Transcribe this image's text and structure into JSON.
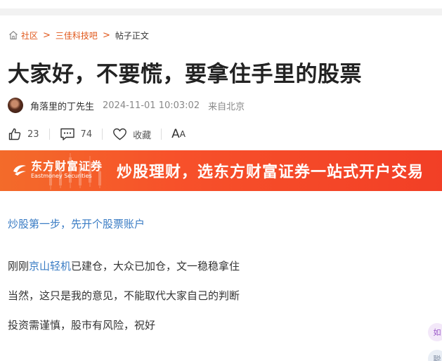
{
  "breadcrumb": {
    "home_icon": "home-icon",
    "items": [
      "社区",
      "三佳科技吧"
    ],
    "current": "帖子正文",
    "link_color": "#e0571a"
  },
  "post": {
    "title": "大家好，不要慌，要拿住手里的股票",
    "author": "角落里的丁先生",
    "time": "2024-11-01 10:03:02",
    "location": "来自北京"
  },
  "actions": {
    "like_count": "23",
    "comment_count": "74",
    "favorite_label": "收藏",
    "font_label_big": "A",
    "font_label_small": "A"
  },
  "banner": {
    "logo_cn": "东方财富证券",
    "logo_en": "Eastmoney Securities",
    "slogan": "炒股理财，选东方财富证券一站式开户交易"
  },
  "promo_link": "炒股第一步，先开个股票账户",
  "content": {
    "line1_before": "刚刚",
    "line1_link": "京山轻机",
    "line1_after": "已建仓，大众已加仓，文一稳稳拿住",
    "line2": "当然，这只是我的意见，不能取代大家自己的判断",
    "line3": "投资需谨慎，股市有风险，祝好"
  },
  "float_buttons": [
    "如",
    "聪"
  ]
}
